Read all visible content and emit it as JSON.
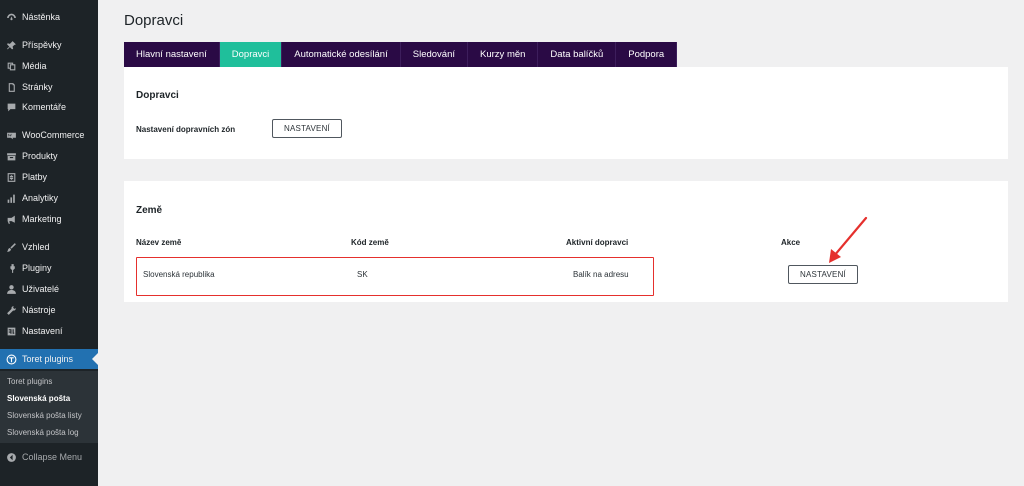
{
  "sidebar": {
    "items": [
      {
        "label": "Nástěnka",
        "icon": "dashboard-icon"
      },
      {
        "label": "Příspěvky",
        "icon": "pin-icon"
      },
      {
        "label": "Média",
        "icon": "media-icon"
      },
      {
        "label": "Stránky",
        "icon": "pages-icon"
      },
      {
        "label": "Komentáře",
        "icon": "comments-icon"
      },
      {
        "label": "WooCommerce",
        "icon": "woocommerce-icon"
      },
      {
        "label": "Produkty",
        "icon": "products-icon"
      },
      {
        "label": "Platby",
        "icon": "payments-icon"
      },
      {
        "label": "Analytiky",
        "icon": "analytics-icon"
      },
      {
        "label": "Marketing",
        "icon": "megaphone-icon"
      },
      {
        "label": "Vzhled",
        "icon": "brush-icon"
      },
      {
        "label": "Pluginy",
        "icon": "plugin-icon"
      },
      {
        "label": "Uživatelé",
        "icon": "users-icon"
      },
      {
        "label": "Nástroje",
        "icon": "wrench-icon"
      },
      {
        "label": "Nastavení",
        "icon": "settings-icon"
      },
      {
        "label": "Toret plugins",
        "icon": "toret-icon"
      }
    ],
    "submenu": [
      "Toret plugins",
      "Slovenská pošta",
      "Slovenská pošta listy",
      "Slovenská pošta log"
    ],
    "collapse_label": "Collapse Menu"
  },
  "page": {
    "title": "Dopravci",
    "tabs": [
      "Hlavní nastavení",
      "Dopravci",
      "Automatické odesílání",
      "Sledování",
      "Kurzy měn",
      "Data balíčků",
      "Podpora"
    ]
  },
  "card_carriers": {
    "title": "Dopravci",
    "zones_label": "Nastavení dopravních zón",
    "settings_button": "NASTAVENÍ"
  },
  "card_countries": {
    "title": "Země",
    "columns": [
      "Název země",
      "Kód země",
      "Aktivní dopravci",
      "Akce"
    ],
    "row": {
      "name": "Slovenská republika",
      "code": "SK",
      "carriers": "Balík na adresu",
      "action": "NASTAVENÍ"
    }
  },
  "colors": {
    "accent_tab": "#1fbf9b",
    "tabs_bg": "#2a0a45",
    "highlight": "#e5302d",
    "sidebar_active": "#2271b1"
  }
}
